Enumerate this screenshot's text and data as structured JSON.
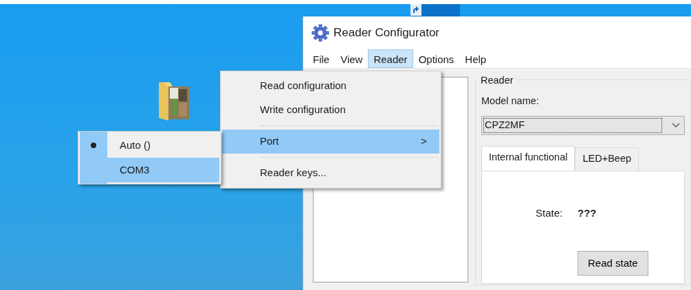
{
  "window": {
    "title": "Reader Configurator"
  },
  "menu_bar": [
    {
      "label": "File",
      "selected": false
    },
    {
      "label": "View",
      "selected": false
    },
    {
      "label": "Reader",
      "selected": true
    },
    {
      "label": "Options",
      "selected": false
    },
    {
      "label": "Help",
      "selected": false
    }
  ],
  "reader_menu": [
    {
      "kind": "command",
      "label": "Read configuration",
      "selected": false
    },
    {
      "kind": "command",
      "label": "Write configuration",
      "selected": false
    },
    {
      "kind": "separator"
    },
    {
      "kind": "submenu",
      "label": "Port",
      "arrow": ">",
      "selected": true
    },
    {
      "kind": "separator"
    },
    {
      "kind": "command",
      "label": "Reader keys...",
      "selected": false
    }
  ],
  "port_submenu": [
    {
      "label": "Auto ()",
      "checked": true,
      "selected": false
    },
    {
      "label": "COM3",
      "checked": false,
      "selected": true
    }
  ],
  "reader_group": {
    "title": "Reader",
    "model_label": "Model name:",
    "model_value": "CPZ2MF",
    "tabs": [
      {
        "label": "Internal functional",
        "selected": true
      },
      {
        "label": "LED+Beep",
        "selected": false
      }
    ],
    "state_label": "State:",
    "state_value": "???",
    "button": "Read state"
  }
}
